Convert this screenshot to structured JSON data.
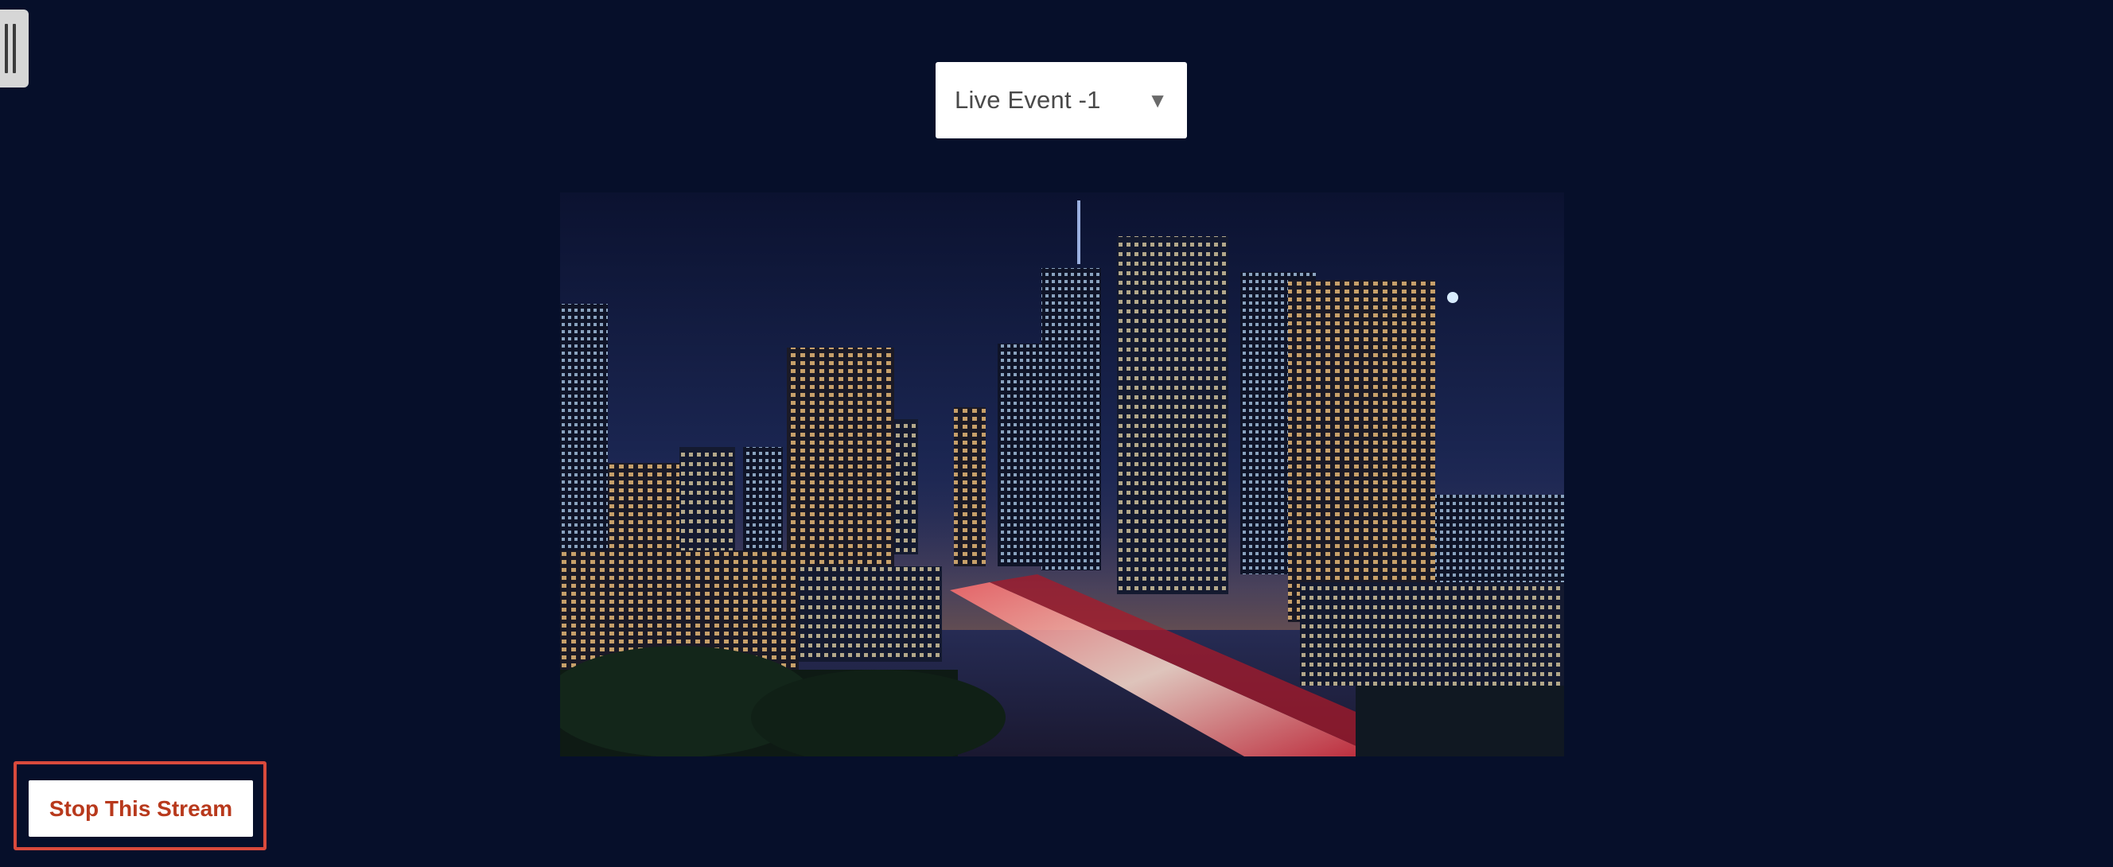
{
  "event_selector": {
    "selected": "Live Event -1",
    "caret_icon": "triangle-down-icon"
  },
  "video": {
    "description_icon": "city-night-skyline-stream"
  },
  "stop_button": {
    "label": "Stop This Stream",
    "text_color": "#b8391c",
    "outline_color": "#d94a3c"
  },
  "sidebar_toggle": {
    "icon": "drag-handle-icon"
  },
  "theme": {
    "background": "#060f2a"
  }
}
